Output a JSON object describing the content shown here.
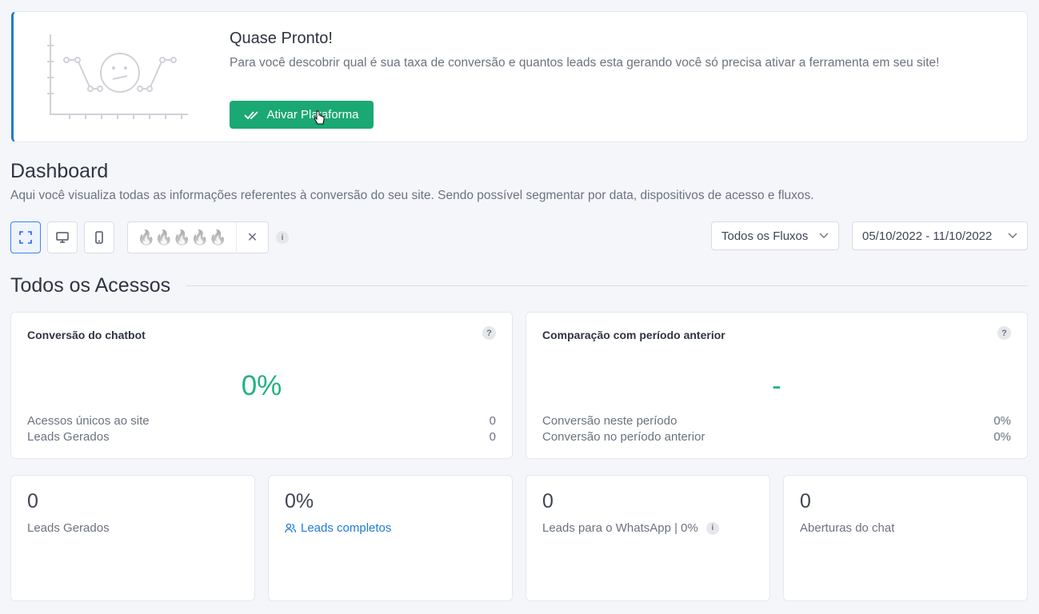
{
  "banner": {
    "title": "Quase Pronto!",
    "text": "Para você descobrir qual é sua taxa de conversão e quantos leads esta gerando você só precisa ativar a ferramenta em seu site!",
    "button_label": "Ativar Plataforma",
    "button_icon": "double-check-icon"
  },
  "dashboard": {
    "title": "Dashboard",
    "subtitle": "Aqui você visualiza todas as informações referentes à conversão do seu site. Sendo possível segmentar por data, dispositivos de acesso e fluxos."
  },
  "toolbar": {
    "devices": [
      "all-devices-icon",
      "desktop-icon",
      "mobile-icon"
    ],
    "fire_icons": "🔥🔥🔥🔥🔥",
    "clear": "✕",
    "info": "i",
    "flow_select": "Todos os Fluxos",
    "date_range": "05/10/2022 - 11/10/2022"
  },
  "section": {
    "title": "Todos os Acessos"
  },
  "conversion_card": {
    "title": "Conversão do chatbot",
    "help": "?",
    "value": "0%",
    "rows": [
      {
        "label": "Acessos únicos ao site",
        "value": "0"
      },
      {
        "label": "Leads Gerados",
        "value": "0"
      }
    ]
  },
  "comparison_card": {
    "title": "Comparação com período anterior",
    "help": "?",
    "value": "-",
    "rows": [
      {
        "label": "Conversão neste período",
        "value": "0%"
      },
      {
        "label": "Conversão no período anterior",
        "value": "0%"
      }
    ]
  },
  "stats": [
    {
      "value": "0",
      "label": "Leads Gerados"
    },
    {
      "value": "0%",
      "label": "Leads completos"
    },
    {
      "value": "0",
      "label": "Leads para o WhatsApp | 0%"
    },
    {
      "value": "0",
      "label": "Aberturas do chat"
    }
  ],
  "colors": {
    "accent_green": "#22b37f",
    "button_green": "#1aa874",
    "link_blue": "#1e7ad6"
  }
}
